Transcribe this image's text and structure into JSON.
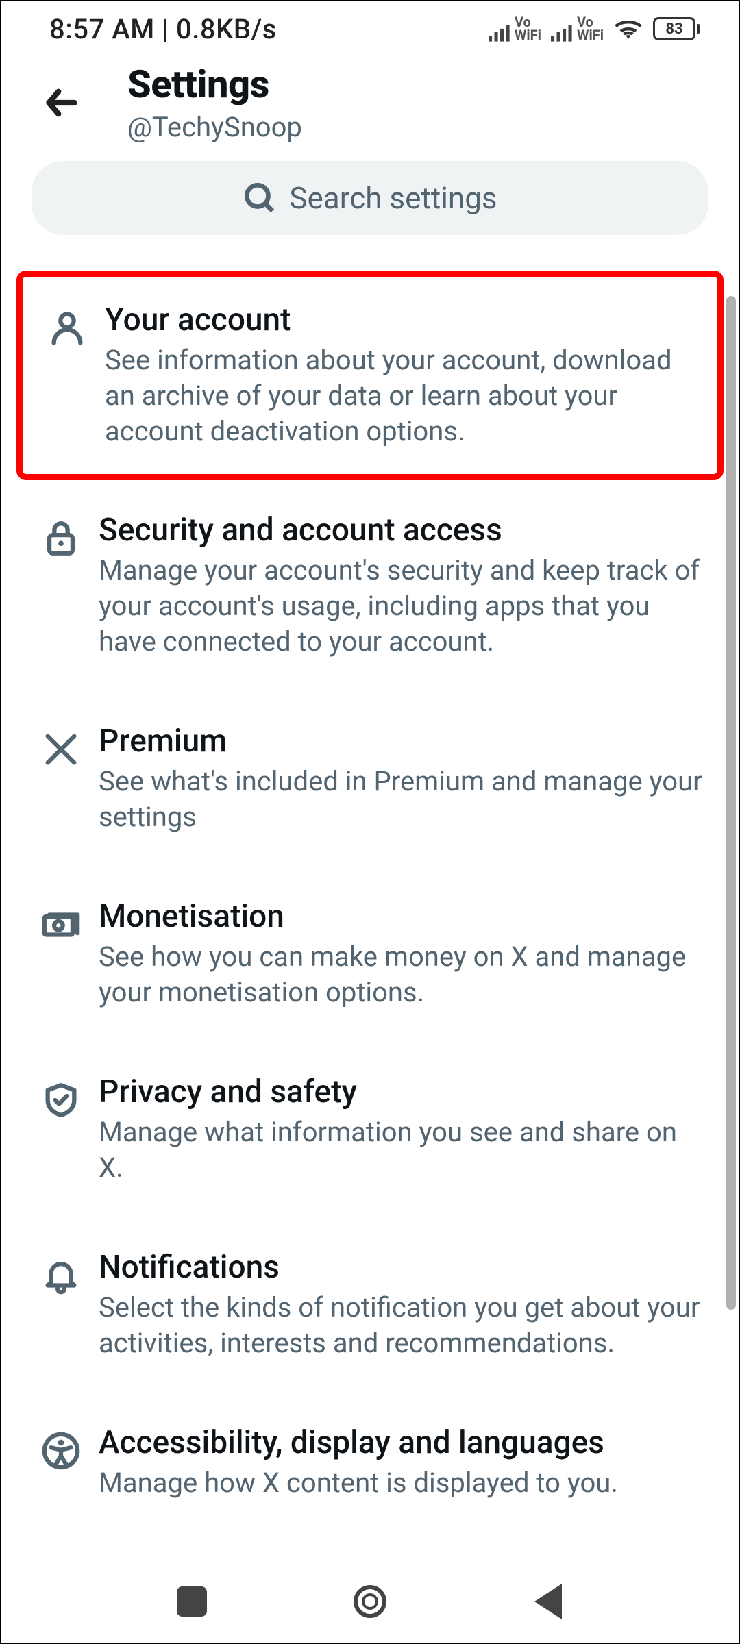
{
  "status": {
    "time": "8:57 AM",
    "speed": "0.8KB/s",
    "vo_label_top": "Vo",
    "vo_label_bottom": "WiFi",
    "battery": "83"
  },
  "header": {
    "title": "Settings",
    "handle": "@TechySnoop"
  },
  "search": {
    "placeholder": "Search settings"
  },
  "items": [
    {
      "icon": "person-icon",
      "title": "Your account",
      "desc": "See information about your account, download an archive of your data or learn about your account deactivation options.",
      "highlighted": true
    },
    {
      "icon": "lock-icon",
      "title": "Security and account access",
      "desc": "Manage your account's security and keep track of your account's usage, including apps that you have connected to your account."
    },
    {
      "icon": "x-icon",
      "title": "Premium",
      "desc": "See what's included in Premium and manage your settings"
    },
    {
      "icon": "money-icon",
      "title": "Monetisation",
      "desc": "See how you can make money on X and manage your monetisation options."
    },
    {
      "icon": "shield-icon",
      "title": "Privacy and safety",
      "desc": "Manage what information you see and share on X."
    },
    {
      "icon": "bell-icon",
      "title": "Notifications",
      "desc": "Select the kinds of notification you get about your activities, interests and recommendations."
    },
    {
      "icon": "accessibility-icon",
      "title": "Accessibility, display and languages",
      "desc": "Manage how X content is displayed to you."
    }
  ]
}
